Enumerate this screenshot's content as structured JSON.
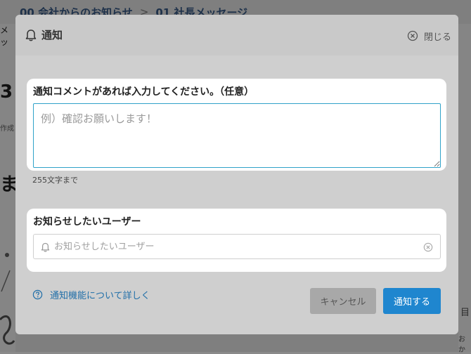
{
  "background": {
    "breadcrumb": [
      "00 会社からのお知らせ",
      "01 社長メッセージ"
    ],
    "breadcrumb_sep": ">",
    "left_snippets": [
      "メッ",
      "3",
      "作成",
      "ま"
    ],
    "right_snippets": [
      "おか",
      "目"
    ]
  },
  "modal": {
    "title": "通知",
    "close_label": "閉じる",
    "comment": {
      "label": "通知コメントがあれば入力してください。（任意）",
      "placeholder": "例）確認お願いします！",
      "value": "",
      "char_limit": "255文字まで"
    },
    "users": {
      "label": "お知らせしたいユーザー",
      "placeholder": "お知らせしたいユーザー",
      "value": ""
    },
    "help_link": "通知機能について詳しく",
    "cancel_label": "キャンセル",
    "notify_label": "通知する"
  },
  "colors": {
    "accent": "#1f86cf",
    "link": "#1f6ea8",
    "focus_border": "#2fa2c9"
  },
  "icons": {
    "header": "bell-icon",
    "close": "close-circle-icon",
    "user_field": "bell-icon",
    "clear": "clear-circle-icon",
    "help": "question-circle-icon"
  }
}
